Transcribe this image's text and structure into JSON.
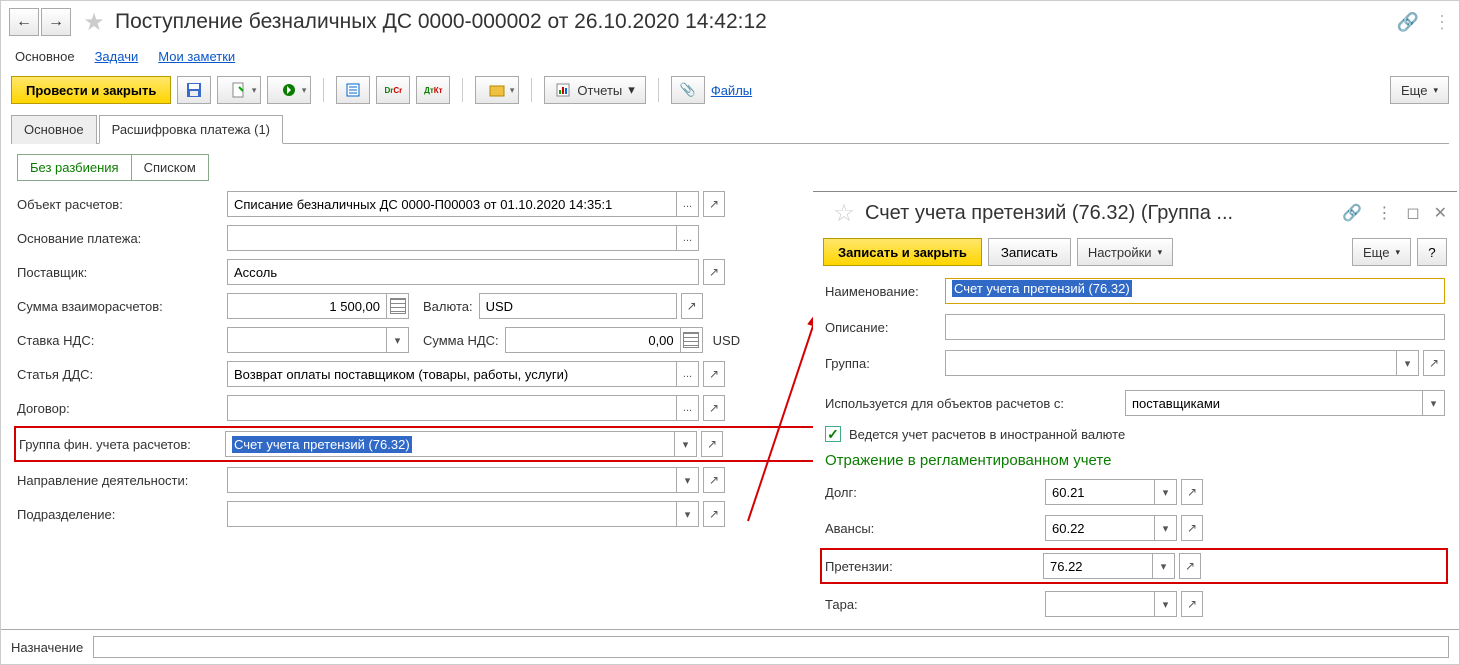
{
  "header": {
    "title": "Поступление безналичных ДС 0000-000002 от 26.10.2020 14:42:12"
  },
  "nav": {
    "main": "Основное",
    "tasks": "Задачи",
    "notes": "Мои заметки"
  },
  "toolbar": {
    "post_close": "Провести и закрыть",
    "reports": "Отчеты",
    "files": "Файлы",
    "more": "Еще"
  },
  "tabs": {
    "main": "Основное",
    "detail": "Расшифровка платежа (1)"
  },
  "toggle": {
    "no_split": "Без разбиения",
    "list": "Списком"
  },
  "form": {
    "object_label": "Объект расчетов:",
    "object_value": "Списание безналичных ДС 0000-П00003 от 01.10.2020 14:35:1",
    "basis_label": "Основание платежа:",
    "basis_value": "",
    "supplier_label": "Поставщик:",
    "supplier_value": "Ассоль",
    "amount_label": "Сумма взаиморасчетов:",
    "amount_value": "1 500,00",
    "currency_label": "Валюта:",
    "currency_value": "USD",
    "vat_rate_label": "Ставка НДС:",
    "vat_rate_value": "",
    "vat_sum_label": "Сумма НДС:",
    "vat_sum_value": "0,00",
    "vat_cur": "USD",
    "dds_label": "Статья ДДС:",
    "dds_value": "Возврат оплаты поставщиком (товары, работы, услуги)",
    "contract_label": "Договор:",
    "contract_value": "",
    "fingroup_label": "Группа фин. учета расчетов:",
    "fingroup_value": "Счет учета претензий (76.32)",
    "direction_label": "Направление деятельности:",
    "direction_value": "",
    "division_label": "Подразделение:",
    "division_value": "",
    "purpose_label": "Назначение"
  },
  "panel": {
    "title": "Счет учета претензий (76.32) (Группа ...",
    "save_close": "Записать и закрыть",
    "save": "Записать",
    "settings": "Настройки",
    "more": "Еще",
    "help": "?",
    "name_label": "Наименование:",
    "name_value": "Счет учета претензий (76.32)",
    "desc_label": "Описание:",
    "desc_value": "",
    "group_label": "Группа:",
    "group_value": "",
    "usedfor_label": "Используется для объектов расчетов с:",
    "usedfor_value": "поставщиками",
    "foreign_label": "Ведется учет расчетов в иностранной валюте",
    "section": "Отражение в регламентированном учете",
    "debt_label": "Долг:",
    "debt_value": "60.21",
    "advance_label": "Авансы:",
    "advance_value": "60.22",
    "claims_label": "Претензии:",
    "claims_value": "76.22",
    "tara_label": "Тара:",
    "tara_value": ""
  }
}
